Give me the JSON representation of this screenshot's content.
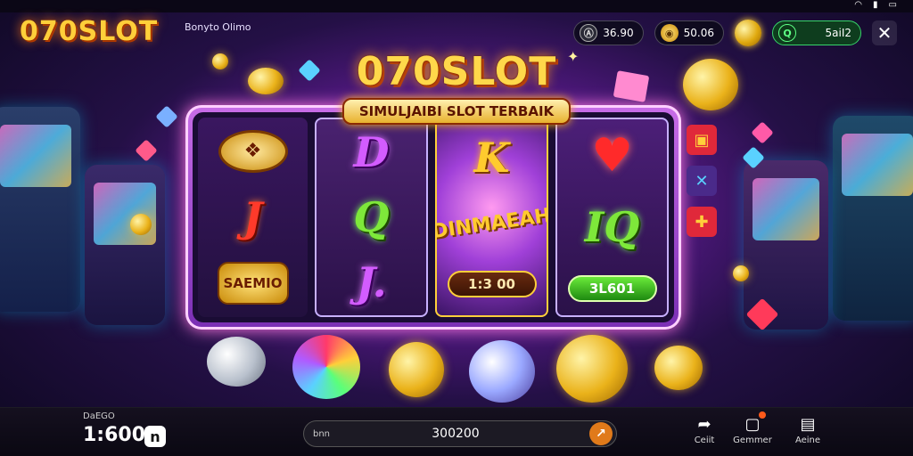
{
  "app": {
    "brand": "070SLOT",
    "subtitle": "Bonyto Olimo",
    "game_title": "070SLOT",
    "banner": "SIMULJAIBI SLOT TERBAIK"
  },
  "top_bar": {
    "info_icon": "info-icon",
    "info_value": "36.90",
    "balance_value": "50.06",
    "green_value": "5aiI2",
    "close_icon": "close-icon"
  },
  "reels": [
    {
      "symbols": [
        "emblem",
        "J",
        "SAEMIO"
      ]
    },
    {
      "symbols": [
        "D",
        "Q",
        "J."
      ]
    },
    {
      "symbols": [
        "K",
        "DINMAEAH"
      ],
      "pill": "1:3 00"
    },
    {
      "symbols": [
        "heart",
        "IQ"
      ],
      "pill": "3L601"
    }
  ],
  "bottom_bar": {
    "bet_label": "DaEGO",
    "bet_value": "1:600",
    "search_label": "bnn",
    "search_value": "300200",
    "nav": [
      {
        "label": "Ceiit",
        "icon": "share-icon"
      },
      {
        "label": "Gemmer",
        "icon": "chat-icon"
      },
      {
        "label": "Aeine",
        "icon": "wallet-icon"
      }
    ]
  },
  "colors": {
    "accent_gold": "#ffcf3a",
    "accent_purple": "#b23be0",
    "accent_green": "#38d46a"
  }
}
